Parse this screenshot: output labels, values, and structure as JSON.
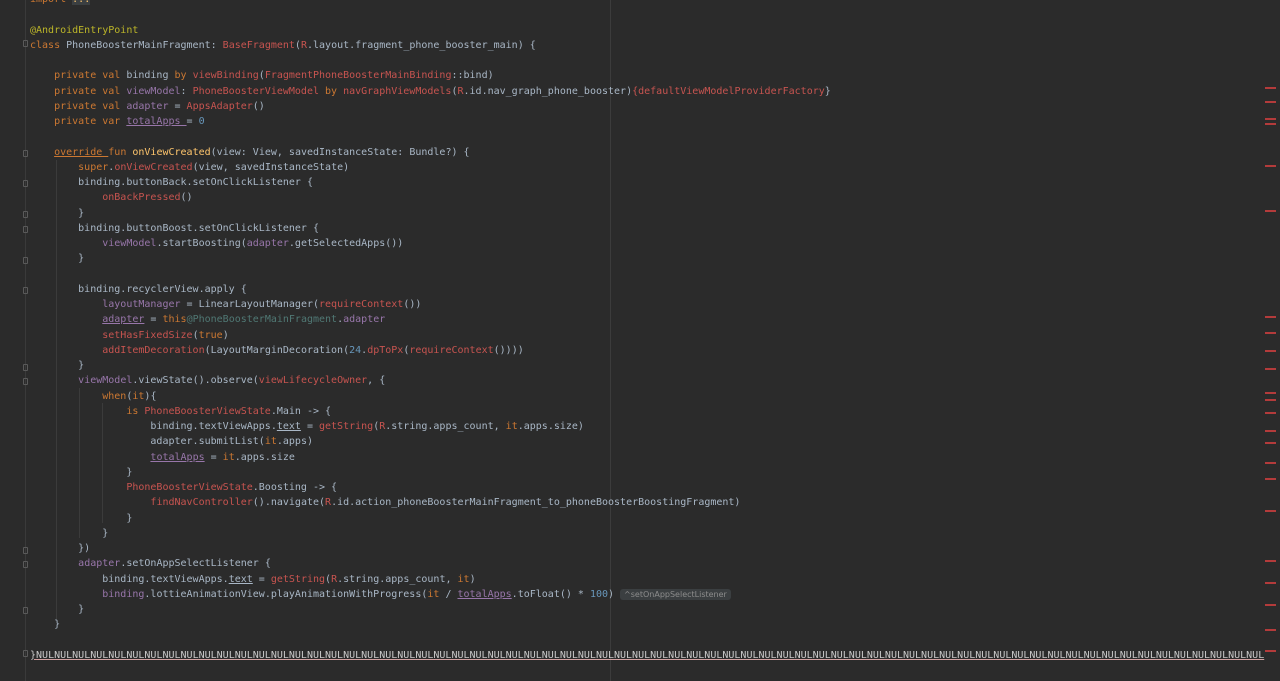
{
  "colors": {
    "background": "#2b2b2b",
    "default": "#a9b7c6",
    "keyword": "#cc7832",
    "annotation": "#bbb529",
    "function": "#ffc66d",
    "member": "#9876aa",
    "number": "#6897bb",
    "warn": "#c75450",
    "label": "#507874",
    "marker": "#b33b3b",
    "hint_text": "#8c8c8c",
    "nul": "#c8c8c8"
  },
  "code_lines": [
    [
      [
        "import ",
        "k"
      ],
      [
        "...",
        "f"
      ]
    ],
    [],
    [
      [
        "@AndroidEntryPoint",
        "a"
      ]
    ],
    [
      [
        "class ",
        "k"
      ],
      [
        "PhoneBoosterMainFragment: ",
        ""
      ],
      [
        "BaseFragment",
        "w"
      ],
      [
        "(",
        ""
      ],
      [
        "R",
        "w"
      ],
      [
        ".layout.fragment_phone_booster_main) {",
        ""
      ]
    ],
    [],
    [
      [
        "    private val ",
        "k"
      ],
      [
        "binding ",
        ""
      ],
      [
        "by ",
        "k"
      ],
      [
        "viewBinding",
        "w"
      ],
      [
        "(",
        ""
      ],
      [
        "FragmentPhoneBoosterMainBinding",
        "w"
      ],
      [
        "::bind)",
        ""
      ]
    ],
    [
      [
        "    private val ",
        "k"
      ],
      [
        "viewModel",
        "m"
      ],
      [
        ": ",
        ""
      ],
      [
        "PhoneBoosterViewModel ",
        "w"
      ],
      [
        "by ",
        "k"
      ],
      [
        "navGraphViewModels",
        "w"
      ],
      [
        "(",
        ""
      ],
      [
        "R",
        "w"
      ],
      [
        ".id.nav_graph_phone_booster)",
        ""
      ],
      [
        "{",
        "w"
      ],
      [
        "defaultViewModelProviderFactory",
        "w"
      ],
      [
        "}",
        ""
      ]
    ],
    [
      [
        "    private val ",
        "k"
      ],
      [
        "adapter ",
        "m"
      ],
      [
        "= ",
        ""
      ],
      [
        "AppsAdapter",
        "w"
      ],
      [
        "()",
        ""
      ]
    ],
    [
      [
        "    private var ",
        "k"
      ],
      [
        "totalApps ",
        "mu"
      ],
      [
        "= ",
        ""
      ],
      [
        "0",
        "n"
      ]
    ],
    [],
    [
      [
        "    ",
        ""
      ],
      [
        "override ",
        "ku"
      ],
      [
        "fun ",
        "k"
      ],
      [
        "onViewCreated",
        "f"
      ],
      [
        "(view: View, savedInstanceState: Bundle?) {",
        ""
      ]
    ],
    [
      [
        "        super",
        "k"
      ],
      [
        ".",
        ""
      ],
      [
        "onViewCreated",
        "w"
      ],
      [
        "(view, savedInstanceState)",
        ""
      ]
    ],
    [
      [
        "        binding.buttonBack.setOnClickListener {",
        ""
      ]
    ],
    [
      [
        "            ",
        ""
      ],
      [
        "onBackPressed",
        "w"
      ],
      [
        "()",
        ""
      ]
    ],
    [
      [
        "        }",
        ""
      ]
    ],
    [
      [
        "        binding.buttonBoost.setOnClickListener {",
        ""
      ]
    ],
    [
      [
        "            ",
        ""
      ],
      [
        "viewModel",
        "m"
      ],
      [
        ".startBoosting(",
        ""
      ],
      [
        "adapter",
        "m"
      ],
      [
        ".getSelectedApps())",
        ""
      ]
    ],
    [
      [
        "        }",
        ""
      ]
    ],
    [],
    [
      [
        "        binding.recyclerView.apply {",
        ""
      ]
    ],
    [
      [
        "            ",
        ""
      ],
      [
        "layoutManager",
        "m"
      ],
      [
        " = LinearLayoutManager(",
        ""
      ],
      [
        "requireContext",
        "w"
      ],
      [
        "())",
        ""
      ]
    ],
    [
      [
        "            ",
        ""
      ],
      [
        "adapter",
        "mu"
      ],
      [
        " = ",
        ""
      ],
      [
        "this",
        "k"
      ],
      [
        "@PhoneBoosterMainFragment",
        "l"
      ],
      [
        ".",
        ""
      ],
      [
        "adapter",
        "m"
      ]
    ],
    [
      [
        "            ",
        ""
      ],
      [
        "setHasFixedSize",
        "w"
      ],
      [
        "(",
        ""
      ],
      [
        "true",
        "k"
      ],
      [
        ")",
        ""
      ]
    ],
    [
      [
        "            ",
        ""
      ],
      [
        "addItemDecoration",
        "w"
      ],
      [
        "(LayoutMarginDecoration(",
        ""
      ],
      [
        "24",
        "n"
      ],
      [
        ".",
        ""
      ],
      [
        "dpToPx",
        "w"
      ],
      [
        "(",
        ""
      ],
      [
        "requireContext",
        "w"
      ],
      [
        "())))",
        ""
      ]
    ],
    [
      [
        "        }",
        ""
      ]
    ],
    [
      [
        "        ",
        ""
      ],
      [
        "viewModel",
        "m"
      ],
      [
        ".viewState().observe(",
        ""
      ],
      [
        "viewLifecycleOwner",
        "w"
      ],
      [
        ", {",
        ""
      ]
    ],
    [
      [
        "            ",
        ""
      ],
      [
        "when",
        "k"
      ],
      [
        "(",
        ""
      ],
      [
        "it",
        "k"
      ],
      [
        "){",
        ""
      ]
    ],
    [
      [
        "                ",
        ""
      ],
      [
        "is ",
        "k"
      ],
      [
        "PhoneBoosterViewState",
        "w"
      ],
      [
        ".Main -> {",
        ""
      ]
    ],
    [
      [
        "                    binding.textViewApps.",
        ""
      ],
      [
        "text",
        "u"
      ],
      [
        " = ",
        ""
      ],
      [
        "getString",
        "w"
      ],
      [
        "(",
        ""
      ],
      [
        "R",
        "w"
      ],
      [
        ".string.apps_count, ",
        ""
      ],
      [
        "it",
        "k"
      ],
      [
        ".apps.size)",
        ""
      ]
    ],
    [
      [
        "                    adapter.submitList(",
        ""
      ],
      [
        "it",
        "k"
      ],
      [
        ".apps)",
        ""
      ]
    ],
    [
      [
        "                    ",
        ""
      ],
      [
        "totalApps",
        "mu"
      ],
      [
        " = ",
        ""
      ],
      [
        "it",
        "k"
      ],
      [
        ".apps.size",
        ""
      ]
    ],
    [
      [
        "                }",
        ""
      ]
    ],
    [
      [
        "                ",
        ""
      ],
      [
        "PhoneBoosterViewState",
        "w"
      ],
      [
        ".Boosting -> {",
        ""
      ]
    ],
    [
      [
        "                    ",
        ""
      ],
      [
        "findNavController",
        "w"
      ],
      [
        "().navigate(",
        ""
      ],
      [
        "R",
        "w"
      ],
      [
        ".id.action_phoneBoosterMainFragment_to_phoneBoosterBoostingFragment)",
        ""
      ]
    ],
    [
      [
        "                }",
        ""
      ]
    ],
    [
      [
        "            }",
        ""
      ]
    ],
    [
      [
        "        })",
        ""
      ]
    ],
    [
      [
        "        ",
        ""
      ],
      [
        "adapter",
        "m"
      ],
      [
        ".setOnAppSelectListener {",
        ""
      ]
    ],
    [
      [
        "            binding.textViewApps.",
        ""
      ],
      [
        "text",
        "u"
      ],
      [
        " = ",
        ""
      ],
      [
        "getString",
        "w"
      ],
      [
        "(",
        ""
      ],
      [
        "R",
        "w"
      ],
      [
        ".string.apps_count, ",
        ""
      ],
      [
        "it",
        "k"
      ],
      [
        ")",
        ""
      ]
    ],
    [
      [
        "            ",
        ""
      ],
      [
        "binding",
        "m"
      ],
      [
        ".lottieAnimationView.playAnimationWithProgress(",
        ""
      ],
      [
        "it",
        "k"
      ],
      [
        " / ",
        ""
      ],
      [
        "totalApps",
        "mu"
      ],
      [
        ".toFloat() * ",
        ""
      ],
      [
        "100",
        "n"
      ],
      [
        ")",
        ""
      ]
    ],
    [
      [
        "        }",
        ""
      ]
    ],
    [
      [
        "    }",
        ""
      ]
    ],
    [],
    [
      [
        "}",
        "nul"
      ],
      [
        "NULNULNULNULNULNULNULNULNULNULNULNULNULNULNULNULNULNULNULNULNULNULNULNULNULNULNULNULNULNULNULNULNULNULNULNULNULNULNULNULNULNULNULNULNULNULNULNULNULNULNULNULNULNULNULNULNULNULNULNULNULNULNULNULNULNULNULNUL",
        "nul"
      ]
    ]
  ],
  "inline_hint": "^setOnAppSelectListener"
}
